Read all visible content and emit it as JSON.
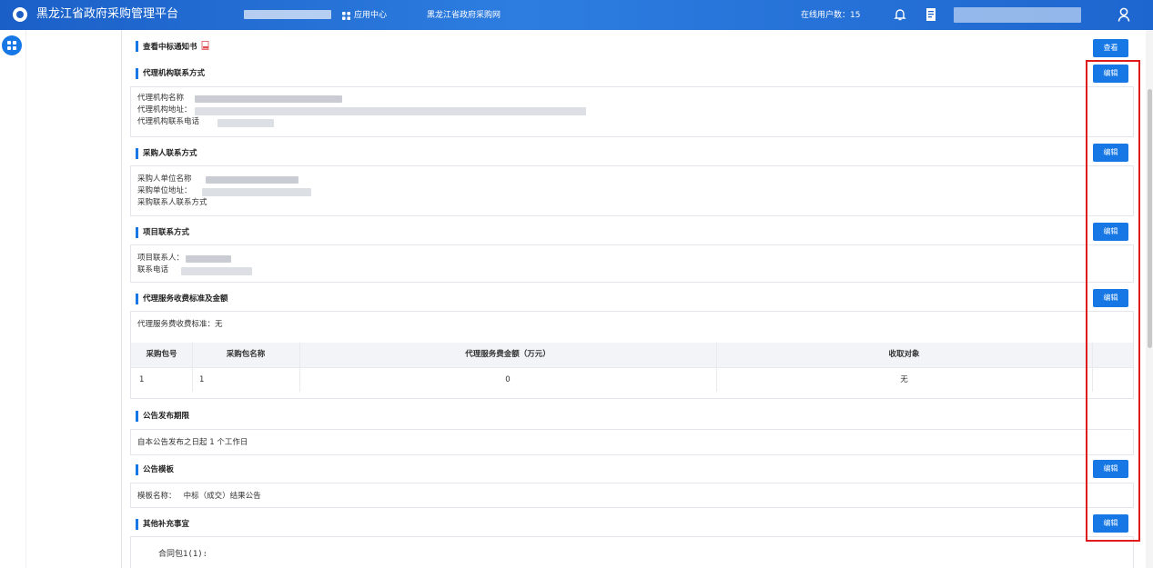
{
  "header": {
    "title": "黑龙江省政府采购管理平台",
    "app_center": "应用中心",
    "portal_link": "黑龙江省政府采购网",
    "online_users_label": "在线用户数：",
    "online_users_count": "15",
    "icons": [
      "logo-icon",
      "grid-icon",
      "bell-icon",
      "document-icon",
      "user-icon"
    ]
  },
  "sections": {
    "award_notice": {
      "title": "查看中标通知书",
      "button": "查看"
    },
    "agency_contact": {
      "title": "代理机构联系方式",
      "button": "编辑",
      "lines": [
        "代理机构名称",
        "代理机构地址：",
        "代理机构联系电话"
      ]
    },
    "purchaser_contact": {
      "title": "采购人联系方式",
      "button": "编辑",
      "lines": [
        "采购人单位名称",
        "采购单位地址：",
        "采购联系人联系方式"
      ]
    },
    "project_contact": {
      "title": "项目联系方式",
      "button": "编辑",
      "lines": [
        "项目联系人：",
        "联系电话"
      ]
    },
    "agency_fee": {
      "title": "代理服务收费标准及金额",
      "button": "编辑",
      "standard": "代理服务费收费标准：无",
      "columns": [
        "采购包号",
        "采购包名称",
        "代理服务费金额（万元）",
        "收取对象"
      ],
      "rows": [
        {
          "package_no": "1",
          "package_name": "1",
          "amount": "0",
          "target": "无"
        }
      ]
    },
    "publish_period": {
      "title": "公告发布期限",
      "text": "自本公告发布之日起 1 个工作日"
    },
    "template": {
      "title": "公告模板",
      "button": "编辑",
      "text": "模板名称：   中标（成交）结果公告"
    },
    "other": {
      "title": "其他补充事宜",
      "button": "编辑",
      "text": "合同包1(1):"
    }
  },
  "colors": {
    "header_blue": "#1d63cb",
    "accent": "#1677e5",
    "highlight_frame": "#e01b1b"
  }
}
